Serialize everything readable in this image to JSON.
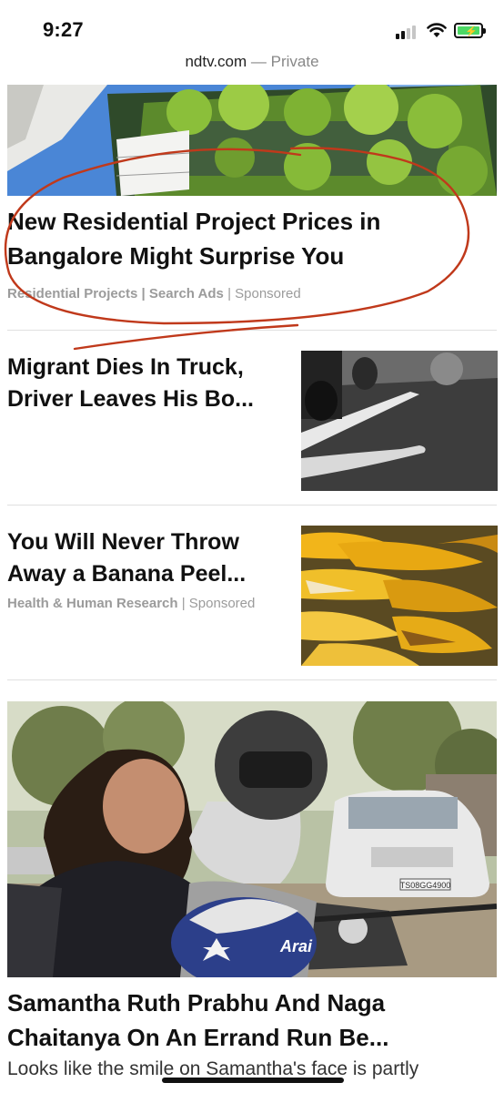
{
  "status_bar": {
    "time": "9:27",
    "battery_color": "#4cd964"
  },
  "url_bar": {
    "domain": "ndtv.com",
    "separator": " — ",
    "mode": "Private"
  },
  "articles": [
    {
      "headline_line1": "New Residential Project Prices in",
      "headline_line2": "Bangalore Might Surprise You",
      "source": "Residential Projects | Search Ads",
      "sponsored": "Sponsored",
      "image": "building-with-vertical-garden"
    },
    {
      "headline_line1": "Migrant Dies In Truck,",
      "headline_line2": "Driver Leaves His Bo...",
      "image": "road-accident-photo"
    },
    {
      "headline_line1": "You Will Never Throw",
      "headline_line2": "Away a Banana Peel...",
      "source": "Health & Human Research",
      "sponsored": "Sponsored",
      "image": "banana-peels-photo"
    },
    {
      "headline_line1": "Samantha Ruth Prabhu And Naga",
      "headline_line2": "Chaitanya On An Errand Run Be...",
      "description": "Looks like the smile on Samantha's face is partly",
      "image": "couple-on-motorbike-photo",
      "plate": "TS08GG4900",
      "helmet_brand": "Arai"
    }
  ],
  "annotation_color": "#c0391b"
}
